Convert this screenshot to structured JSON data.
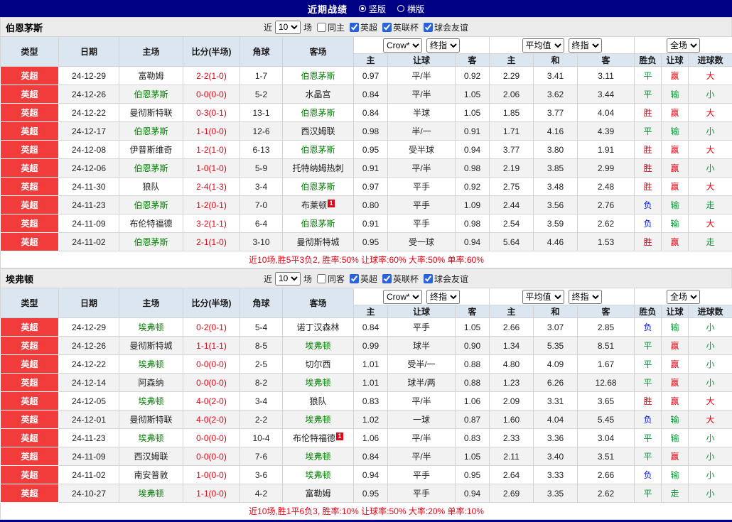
{
  "topbar": {
    "title": "近期战绩",
    "vertical_label": "竖版",
    "horizontal_label": "横版"
  },
  "colors": {
    "topbar_bg": "#000084",
    "league_cell_bg": "#f23c3c",
    "win": "#e60012",
    "draw": "#009933",
    "lose": "#0016e6",
    "self_team": "#008000",
    "score": "#e60012",
    "header_bg": "#dce6f1"
  },
  "filter": {
    "prefix": "近",
    "count": "10",
    "suffix": "场",
    "leagues": [
      "英超",
      "英联杯",
      "球会友谊"
    ]
  },
  "table_headers": {
    "left": [
      "类型",
      "日期",
      "主场",
      "比分(半场)",
      "角球",
      "客场"
    ],
    "groups": [
      {
        "selects": [
          "Crow*",
          "终指"
        ],
        "cols": [
          "主",
          "让球",
          "客"
        ]
      },
      {
        "selects": [
          "平均值",
          "终指"
        ],
        "cols": [
          "主",
          "和",
          "客"
        ]
      },
      {
        "selects": [
          "全场"
        ],
        "cols": [
          "胜负",
          "让球",
          "进球数"
        ]
      }
    ]
  },
  "sections": [
    {
      "team": "伯恩茅斯",
      "same_label": "同主",
      "summary": "近10场,胜5平3负2, 胜率:50% 让球率:60% 大率:50% 单率:60%",
      "rows": [
        {
          "league": "英超",
          "date": "24-12-29",
          "home": "富勒姆",
          "home_self": false,
          "score": "2-2(1-0)",
          "corner": "1-7",
          "away": "伯恩茅斯",
          "away_self": true,
          "odds": [
            "0.97",
            "平/半",
            "0.92"
          ],
          "avg": [
            "2.29",
            "3.41",
            "3.11"
          ],
          "res": [
            "平",
            "赢",
            "大"
          ]
        },
        {
          "league": "英超",
          "date": "24-12-26",
          "home": "伯恩茅斯",
          "home_self": true,
          "score": "0-0(0-0)",
          "corner": "5-2",
          "away": "水晶宫",
          "away_self": false,
          "odds": [
            "0.84",
            "平/半",
            "1.05"
          ],
          "avg": [
            "2.06",
            "3.62",
            "3.44"
          ],
          "res": [
            "平",
            "输",
            "小"
          ]
        },
        {
          "league": "英超",
          "date": "24-12-22",
          "home": "曼彻斯特联",
          "home_self": false,
          "score": "0-3(0-1)",
          "corner": "13-1",
          "away": "伯恩茅斯",
          "away_self": true,
          "odds": [
            "0.84",
            "半球",
            "1.05"
          ],
          "avg": [
            "1.85",
            "3.77",
            "4.04"
          ],
          "res": [
            "胜",
            "赢",
            "大"
          ]
        },
        {
          "league": "英超",
          "date": "24-12-17",
          "home": "伯恩茅斯",
          "home_self": true,
          "score": "1-1(0-0)",
          "corner": "12-6",
          "away": "西汉姆联",
          "away_self": false,
          "odds": [
            "0.98",
            "半/一",
            "0.91"
          ],
          "avg": [
            "1.71",
            "4.16",
            "4.39"
          ],
          "res": [
            "平",
            "输",
            "小"
          ]
        },
        {
          "league": "英超",
          "date": "24-12-08",
          "home": "伊普斯维奇",
          "home_self": false,
          "score": "1-2(1-0)",
          "corner": "6-13",
          "away": "伯恩茅斯",
          "away_self": true,
          "odds": [
            "0.95",
            "受半球",
            "0.94"
          ],
          "avg": [
            "3.77",
            "3.80",
            "1.91"
          ],
          "res": [
            "胜",
            "赢",
            "大"
          ]
        },
        {
          "league": "英超",
          "date": "24-12-06",
          "home": "伯恩茅斯",
          "home_self": true,
          "score": "1-0(1-0)",
          "corner": "5-9",
          "away": "托特纳姆热刺",
          "away_self": false,
          "odds": [
            "0.91",
            "平/半",
            "0.98"
          ],
          "avg": [
            "2.19",
            "3.85",
            "2.99"
          ],
          "res": [
            "胜",
            "赢",
            "小"
          ]
        },
        {
          "league": "英超",
          "date": "24-11-30",
          "home": "狼队",
          "home_self": false,
          "score": "2-4(1-3)",
          "corner": "3-4",
          "away": "伯恩茅斯",
          "away_self": true,
          "odds": [
            "0.97",
            "平手",
            "0.92"
          ],
          "avg": [
            "2.75",
            "3.48",
            "2.48"
          ],
          "res": [
            "胜",
            "赢",
            "大"
          ]
        },
        {
          "league": "英超",
          "date": "24-11-23",
          "home": "伯恩茅斯",
          "home_self": true,
          "score": "1-2(0-1)",
          "corner": "7-0",
          "away": "布莱顿",
          "away_self": false,
          "away_badge": "1",
          "odds": [
            "0.80",
            "平手",
            "1.09"
          ],
          "avg": [
            "2.44",
            "3.56",
            "2.76"
          ],
          "res": [
            "负",
            "输",
            "走"
          ]
        },
        {
          "league": "英超",
          "date": "24-11-09",
          "home": "布伦特福德",
          "home_self": false,
          "score": "3-2(1-1)",
          "corner": "6-4",
          "away": "伯恩茅斯",
          "away_self": true,
          "odds": [
            "0.91",
            "平手",
            "0.98"
          ],
          "avg": [
            "2.54",
            "3.59",
            "2.62"
          ],
          "res": [
            "负",
            "输",
            "大"
          ]
        },
        {
          "league": "英超",
          "date": "24-11-02",
          "home": "伯恩茅斯",
          "home_self": true,
          "score": "2-1(1-0)",
          "corner": "3-10",
          "away": "曼彻斯特城",
          "away_self": false,
          "odds": [
            "0.95",
            "受一球",
            "0.94"
          ],
          "avg": [
            "5.64",
            "4.46",
            "1.53"
          ],
          "res": [
            "胜",
            "赢",
            "走"
          ]
        }
      ]
    },
    {
      "team": "埃弗顿",
      "same_label": "同客",
      "summary": "近10场,胜1平6负3, 胜率:10% 让球率:50% 大率:20% 单率:10%",
      "rows": [
        {
          "league": "英超",
          "date": "24-12-29",
          "home": "埃弗顿",
          "home_self": true,
          "score": "0-2(0-1)",
          "corner": "5-4",
          "away": "诺丁汉森林",
          "away_self": false,
          "odds": [
            "0.84",
            "平手",
            "1.05"
          ],
          "avg": [
            "2.66",
            "3.07",
            "2.85"
          ],
          "res": [
            "负",
            "输",
            "小"
          ]
        },
        {
          "league": "英超",
          "date": "24-12-26",
          "home": "曼彻斯特城",
          "home_self": false,
          "score": "1-1(1-1)",
          "corner": "8-5",
          "away": "埃弗顿",
          "away_self": true,
          "odds": [
            "0.99",
            "球半",
            "0.90"
          ],
          "avg": [
            "1.34",
            "5.35",
            "8.51"
          ],
          "res": [
            "平",
            "赢",
            "小"
          ]
        },
        {
          "league": "英超",
          "date": "24-12-22",
          "home": "埃弗顿",
          "home_self": true,
          "score": "0-0(0-0)",
          "corner": "2-5",
          "away": "切尔西",
          "away_self": false,
          "odds": [
            "1.01",
            "受半/一",
            "0.88"
          ],
          "avg": [
            "4.80",
            "4.09",
            "1.67"
          ],
          "res": [
            "平",
            "赢",
            "小"
          ]
        },
        {
          "league": "英超",
          "date": "24-12-14",
          "home": "阿森纳",
          "home_self": false,
          "score": "0-0(0-0)",
          "corner": "8-2",
          "away": "埃弗顿",
          "away_self": true,
          "odds": [
            "1.01",
            "球半/两",
            "0.88"
          ],
          "avg": [
            "1.23",
            "6.26",
            "12.68"
          ],
          "res": [
            "平",
            "赢",
            "小"
          ]
        },
        {
          "league": "英超",
          "date": "24-12-05",
          "home": "埃弗顿",
          "home_self": true,
          "score": "4-0(2-0)",
          "corner": "3-4",
          "away": "狼队",
          "away_self": false,
          "odds": [
            "0.83",
            "平/半",
            "1.06"
          ],
          "avg": [
            "2.09",
            "3.31",
            "3.65"
          ],
          "res": [
            "胜",
            "赢",
            "大"
          ]
        },
        {
          "league": "英超",
          "date": "24-12-01",
          "home": "曼彻斯特联",
          "home_self": false,
          "score": "4-0(2-0)",
          "corner": "2-2",
          "away": "埃弗顿",
          "away_self": true,
          "odds": [
            "1.02",
            "一球",
            "0.87"
          ],
          "avg": [
            "1.60",
            "4.04",
            "5.45"
          ],
          "res": [
            "负",
            "输",
            "大"
          ]
        },
        {
          "league": "英超",
          "date": "24-11-23",
          "home": "埃弗顿",
          "home_self": true,
          "score": "0-0(0-0)",
          "corner": "10-4",
          "away": "布伦特福德",
          "away_self": false,
          "away_badge": "1",
          "odds": [
            "1.06",
            "平/半",
            "0.83"
          ],
          "avg": [
            "2.33",
            "3.36",
            "3.04"
          ],
          "res": [
            "平",
            "输",
            "小"
          ]
        },
        {
          "league": "英超",
          "date": "24-11-09",
          "home": "西汉姆联",
          "home_self": false,
          "score": "0-0(0-0)",
          "corner": "7-6",
          "away": "埃弗顿",
          "away_self": true,
          "odds": [
            "0.84",
            "平/半",
            "1.05"
          ],
          "avg": [
            "2.11",
            "3.40",
            "3.51"
          ],
          "res": [
            "平",
            "赢",
            "小"
          ]
        },
        {
          "league": "英超",
          "date": "24-11-02",
          "home": "南安普敦",
          "home_self": false,
          "score": "1-0(0-0)",
          "corner": "3-6",
          "away": "埃弗顿",
          "away_self": true,
          "odds": [
            "0.94",
            "平手",
            "0.95"
          ],
          "avg": [
            "2.64",
            "3.33",
            "2.66"
          ],
          "res": [
            "负",
            "输",
            "小"
          ]
        },
        {
          "league": "英超",
          "date": "24-10-27",
          "home": "埃弗顿",
          "home_self": true,
          "score": "1-1(0-0)",
          "corner": "4-2",
          "away": "富勒姆",
          "away_self": false,
          "odds": [
            "0.95",
            "平手",
            "0.94"
          ],
          "avg": [
            "2.69",
            "3.35",
            "2.62"
          ],
          "res": [
            "平",
            "走",
            "小"
          ]
        }
      ]
    }
  ]
}
